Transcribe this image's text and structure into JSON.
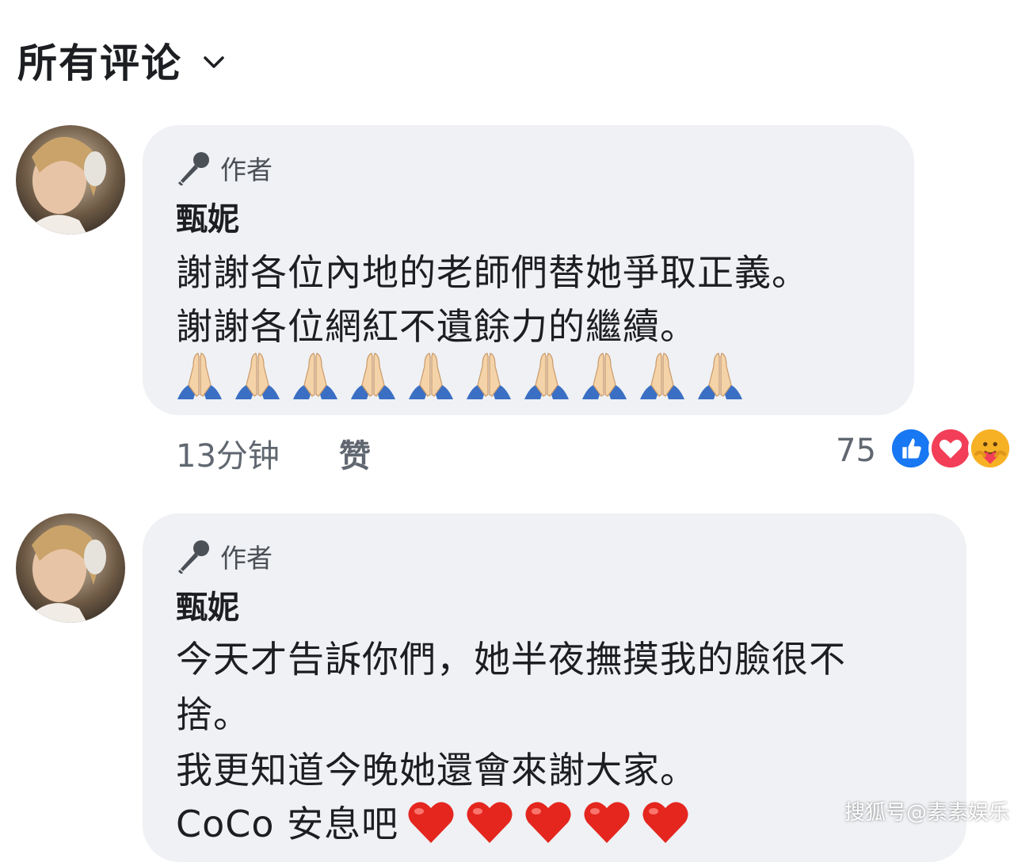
{
  "header": {
    "title": "所有评论"
  },
  "comments": [
    {
      "author_label": "作者",
      "name": "甄妮",
      "lines": [
        "謝謝各位內地的老師們替她爭取正義。",
        "謝謝各位網紅不遺餘力的繼續。"
      ],
      "emoji": "folded-hands-icon",
      "emoji_count": 10,
      "time": "13分钟",
      "like_label": "赞",
      "reaction_count": "75"
    },
    {
      "author_label": "作者",
      "name": "甄妮",
      "lines": [
        "今天才告訴你們，她半夜撫摸我的臉很不",
        "捨。",
        "我更知道今晚她還會來謝大家。",
        "CoCo 安息吧"
      ],
      "emoji": "red-heart-icon",
      "emoji_count": 5
    }
  ],
  "reactions": [
    "like-icon",
    "love-icon",
    "care-icon"
  ],
  "watermark": "搜狐号@素素娱乐",
  "colors": {
    "bubble": "#eff1f4",
    "like_blue": "#1877f2",
    "love_red": "#f33e58",
    "care_yellow": "#f7b125"
  }
}
